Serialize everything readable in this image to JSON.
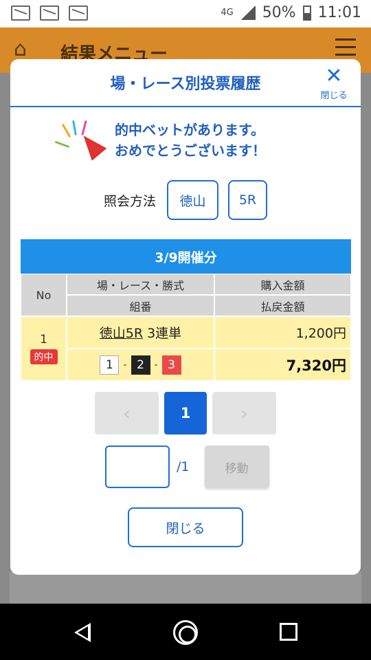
{
  "status_bar": {
    "battery": "50%",
    "time": "11:01",
    "network": "4G"
  },
  "app_bar": {
    "title": "結果メニュー"
  },
  "modal": {
    "title": "場・レース別投票履歴",
    "close_icon_label": "閉じる",
    "congrats_line1": "的中ベットがあります。",
    "congrats_line2": "おめでとうございます！",
    "lookup_label": "照会方法",
    "lookup_venue": "徳山",
    "lookup_race": "5R"
  },
  "table": {
    "date_header": "3/9開催分",
    "headers": {
      "no": "No",
      "race_type": "場・レース・勝式",
      "purchase": "購入金額",
      "combo": "組番",
      "payout": "払戻金額"
    },
    "rows": [
      {
        "no": "1",
        "badge": "的中",
        "race": "徳山5R",
        "bet_type": "3連単",
        "boats": [
          "1",
          "2",
          "3"
        ],
        "purchase": "1,200円",
        "payout": "7,320円"
      }
    ]
  },
  "pagination": {
    "prev": "‹",
    "current": "1",
    "next": "›",
    "total": "/1",
    "input_value": "",
    "move_label": "移動"
  },
  "close_button": "閉じる",
  "colors": {
    "accent": "#1f6fd1",
    "header_blue": "#1e90e8",
    "hit_row": "#fff2a8",
    "hit_badge": "#e83838",
    "app_orange": "#d98a28"
  }
}
